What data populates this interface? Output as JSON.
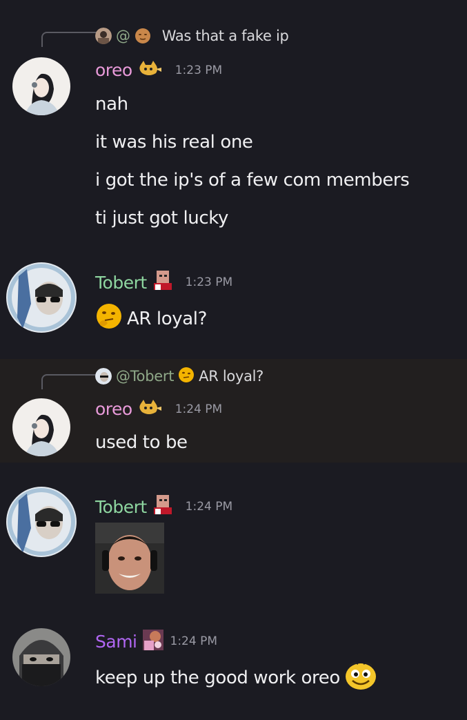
{
  "messages": [
    {
      "reply": {
        "prefix": "@",
        "text": "Was that a fake ip"
      },
      "author": "oreo",
      "time": "1:23 PM",
      "lines": [
        "nah",
        "it was his real one",
        "i got the ip's of a few com members",
        "ti just got lucky"
      ]
    },
    {
      "author": "Tobert",
      "time": "1:23 PM",
      "lines": [
        "AR loyal?"
      ],
      "emoji": "thinking-face-icon"
    },
    {
      "reply": {
        "mention": "@Tobert",
        "text": "AR loyal?"
      },
      "author": "oreo",
      "time": "1:24 PM",
      "lines": [
        "used to be"
      ]
    },
    {
      "author": "Tobert",
      "time": "1:24 PM",
      "attachment": "face-photo"
    },
    {
      "author": "Sami",
      "time": "1:24 PM",
      "lines": [
        "keep up the good work oreo"
      ],
      "emoji": "goofy-smile-icon"
    }
  ],
  "colors": {
    "background": "#1b1b22",
    "oreo": "#e89ad9",
    "tobert": "#8ed6a0",
    "sami": "#b066f2"
  }
}
